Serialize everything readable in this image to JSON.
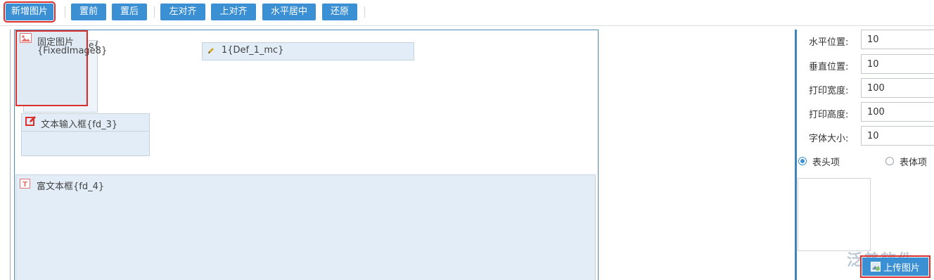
{
  "toolbar": {
    "buttons": [
      "新增图片",
      "置前",
      "置后",
      "左对齐",
      "上对齐",
      "水平居中",
      "还原"
    ]
  },
  "canvas": {
    "fixed_image": {
      "title": "固定图片",
      "code": "{FixedImage8}",
      "overflow_char": "e{"
    },
    "def_field": {
      "label": "1{Def_1_mc}"
    },
    "text_input": {
      "label": "文本输入框{fd_3}"
    },
    "rich_text": {
      "label": "富文本框{fd_4}"
    }
  },
  "properties": {
    "horizontal": {
      "label": "水平位置:",
      "value": "10"
    },
    "vertical": {
      "label": "垂直位置:",
      "value": "10"
    },
    "print_width": {
      "label": "打印宽度:",
      "value": "100"
    },
    "print_height": {
      "label": "打印高度:",
      "value": "100"
    },
    "font_size": {
      "label": "字体大小:",
      "value": "10"
    }
  },
  "radios": [
    {
      "label": "表头项",
      "checked": true
    },
    {
      "label": "表体项",
      "checked": false
    }
  ],
  "upload": {
    "label": "上传图片"
  },
  "watermark": "泛普软件",
  "colors": {
    "accent": "#3b8fd3",
    "highlight": "#d9302e",
    "field_bg": "#e2edf7"
  }
}
